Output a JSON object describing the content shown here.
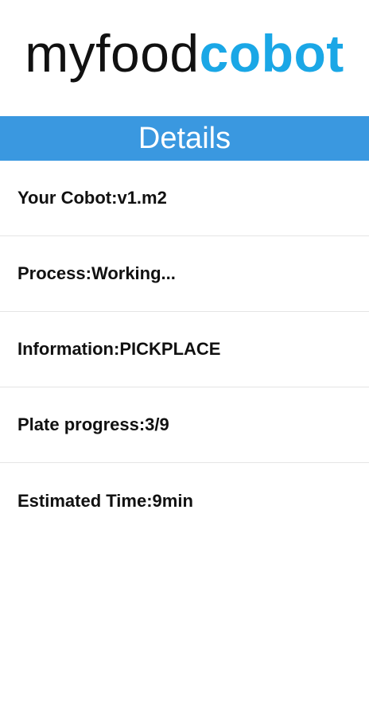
{
  "logo": {
    "part_a": "myfood",
    "part_b": "cobot"
  },
  "header": {
    "title": "Details"
  },
  "details": [
    {
      "label": "Your Cobot: ",
      "value": "v1.m2"
    },
    {
      "label": "Process: ",
      "value": "Working..."
    },
    {
      "label": "Information: ",
      "value": "PICKPLACE"
    },
    {
      "label": "Plate progress: ",
      "value": "3/9"
    },
    {
      "label": "Estimated Time: ",
      "value": "9min"
    }
  ],
  "colors": {
    "brand_accent": "#1aa7e6",
    "header_bar": "#3a98e0",
    "text": "#111111"
  }
}
